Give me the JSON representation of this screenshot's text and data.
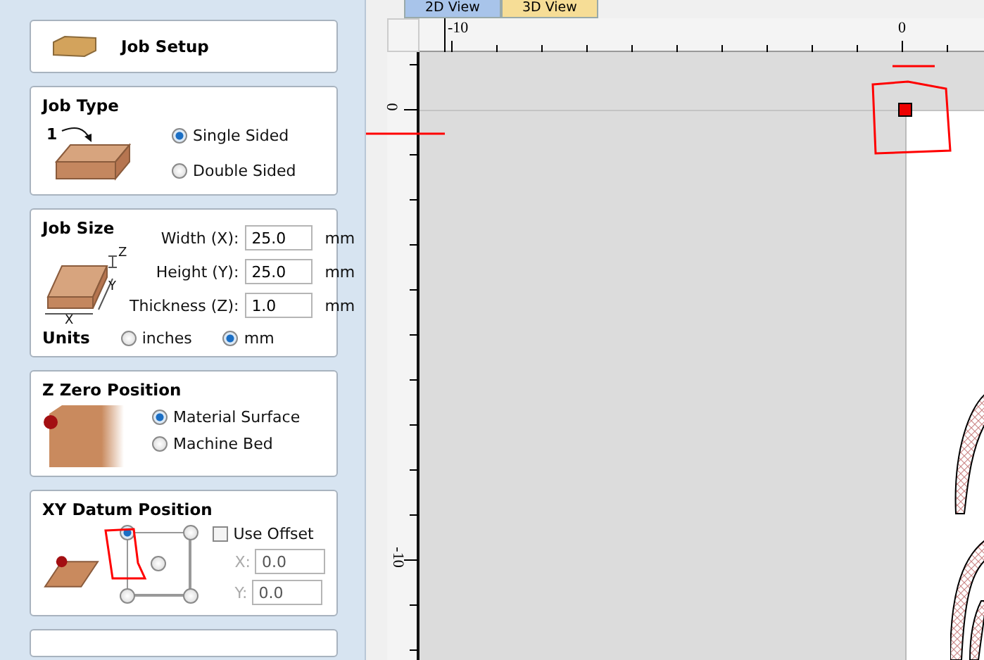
{
  "sidebar": {
    "job_setup": {
      "title": "Job Setup"
    },
    "job_type": {
      "title": "Job Type",
      "step_label": "1",
      "options": [
        {
          "label": "Single Sided",
          "selected": true
        },
        {
          "label": "Double Sided",
          "selected": false
        }
      ]
    },
    "job_size": {
      "title": "Job Size",
      "fields": [
        {
          "label": "Width (X):",
          "value": "25.0",
          "unit": "mm"
        },
        {
          "label": "Height (Y):",
          "value": "25.0",
          "unit": "mm"
        },
        {
          "label": "Thickness (Z):",
          "value": "1.0",
          "unit": "mm"
        }
      ],
      "axis_labels": [
        "Z",
        "Y",
        "X"
      ],
      "units_label": "Units",
      "units": [
        {
          "label": "inches",
          "selected": false
        },
        {
          "label": "mm",
          "selected": true
        }
      ]
    },
    "z_zero": {
      "title": "Z Zero Position",
      "options": [
        {
          "label": "Material Surface",
          "selected": true
        },
        {
          "label": "Machine Bed",
          "selected": false
        }
      ]
    },
    "xy_datum": {
      "title": "XY Datum Position",
      "anchors": [
        {
          "selected": true
        },
        {
          "selected": false
        },
        {
          "selected": false
        },
        {
          "selected": false
        },
        {
          "selected": false
        }
      ],
      "use_offset": {
        "label": "Use Offset",
        "checked": false
      },
      "offset_fields": [
        {
          "label": "X:",
          "value": "0.0",
          "disabled": true
        },
        {
          "label": "Y:",
          "value": "0.0",
          "disabled": true
        }
      ]
    }
  },
  "view": {
    "tabs": [
      {
        "label": "2D View",
        "selected": true
      },
      {
        "label": "3D View",
        "selected": false
      }
    ],
    "ruler_x_labels": [
      "-10",
      "0"
    ],
    "ruler_y_labels": [
      "0",
      "-10"
    ]
  }
}
